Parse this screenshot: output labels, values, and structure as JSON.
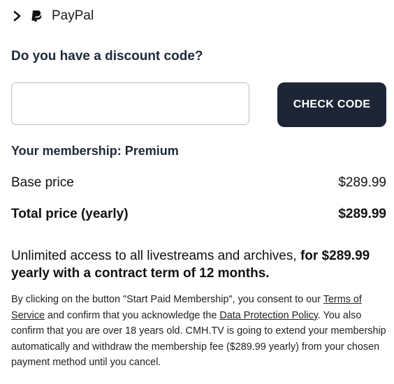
{
  "payment_method": {
    "label": "PayPal",
    "expand_icon": "chevron-right-icon",
    "logo_icon": "paypal-logo-icon"
  },
  "discount": {
    "title": "Do you have a discount code?",
    "input_value": "",
    "input_placeholder": "",
    "button_label": "CHECK CODE"
  },
  "membership": {
    "title": "Your membership: Premium",
    "base_price_label": "Base price",
    "base_price_value": "$289.99",
    "total_price_label": "Total price (yearly)",
    "total_price_value": "$289.99"
  },
  "description": {
    "plain": "Unlimited access to all livestreams and archives,",
    "bold": "for $289.99 yearly with a contract term of 12 months."
  },
  "legal": {
    "part1": "By clicking on the button \"Start Paid Membership\", you consent to our ",
    "terms_link": "Terms of Service",
    "part2": " and confirm that you acknowledge the ",
    "privacy_link": "Data Protection Policy",
    "part3": ". You also confirm that you are over 18 years old. CMH.TV is going to extend your membership automatically and withdraw the membership fee ($289.99 yearly) from your chosen payment method until you cancel."
  },
  "colors": {
    "button_bg": "#1e2636",
    "heading_text": "#1f2937",
    "input_border": "#b9bec7"
  }
}
